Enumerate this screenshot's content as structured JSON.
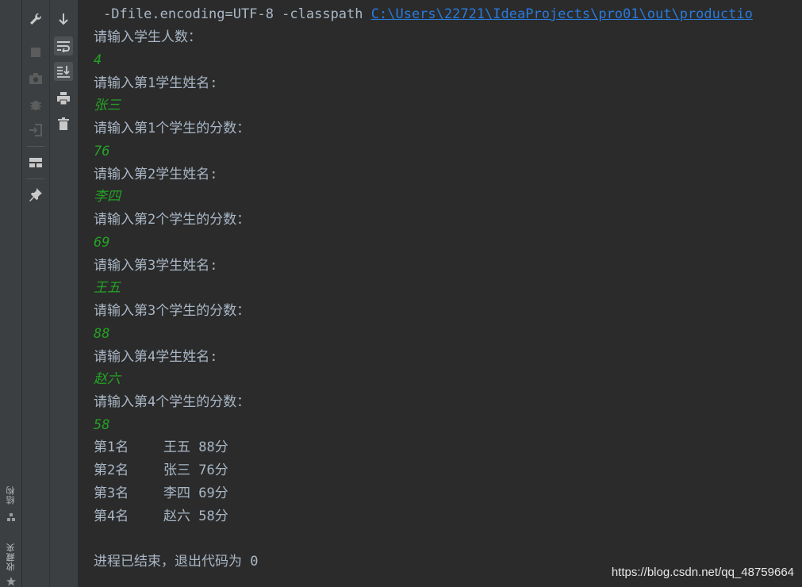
{
  "command": {
    "text": " -Dfile.encoding=UTF-8 -classpath ",
    "link": "C:\\Users\\22721\\IdeaProjects\\pro01\\out\\productio"
  },
  "output": [
    {
      "text": "请输入学生人数：",
      "kind": "prompt"
    },
    {
      "text": "4",
      "kind": "input"
    },
    {
      "text": "请输入第1学生姓名:",
      "kind": "prompt"
    },
    {
      "text": "张三",
      "kind": "input"
    },
    {
      "text": "请输入第1个学生的分数：",
      "kind": "prompt"
    },
    {
      "text": "76",
      "kind": "input"
    },
    {
      "text": "请输入第2学生姓名:",
      "kind": "prompt"
    },
    {
      "text": "李四",
      "kind": "input"
    },
    {
      "text": "请输入第2个学生的分数：",
      "kind": "prompt"
    },
    {
      "text": "69",
      "kind": "input"
    },
    {
      "text": "请输入第3学生姓名:",
      "kind": "prompt"
    },
    {
      "text": "王五",
      "kind": "input"
    },
    {
      "text": "请输入第3个学生的分数：",
      "kind": "prompt"
    },
    {
      "text": "88",
      "kind": "input"
    },
    {
      "text": "请输入第4学生姓名:",
      "kind": "prompt"
    },
    {
      "text": "赵六",
      "kind": "input"
    },
    {
      "text": "请输入第4个学生的分数：",
      "kind": "prompt"
    },
    {
      "text": "58",
      "kind": "input"
    }
  ],
  "ranking": [
    {
      "rank": "第1名",
      "result": "王五 88分"
    },
    {
      "rank": "第2名",
      "result": "张三 76分"
    },
    {
      "rank": "第3名",
      "result": "李四 69分"
    },
    {
      "rank": "第4名",
      "result": "赵六 58分"
    }
  ],
  "exit_message": "进程已结束，退出代码为 0",
  "side_tabs": {
    "structure": "结构",
    "favorites": "收藏夹"
  },
  "watermark": "https://blog.csdn.net/qq_48759664",
  "colors": {
    "background": "#2b2b2b",
    "text": "#a9b7c6",
    "user_input": "#24a324",
    "link": "#287bde"
  },
  "icons": [
    "wrench-icon",
    "stop-icon",
    "camera-icon",
    "bug-icon",
    "login-icon",
    "layout-icon",
    "pin-icon",
    "down-arrow-icon",
    "soft-wrap-icon",
    "scroll-to-end-icon",
    "print-icon",
    "trash-icon",
    "star-icon"
  ]
}
